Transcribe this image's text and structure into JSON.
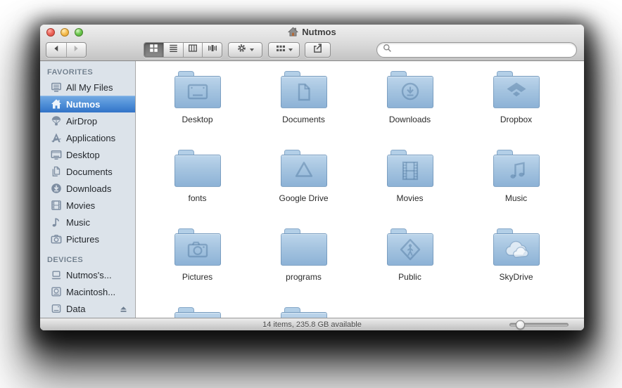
{
  "window": {
    "title": "Nutmos",
    "title_icon": "home-icon",
    "controls": [
      {
        "name": "close",
        "color": "#ee6a5f"
      },
      {
        "name": "minimize",
        "color": "#f6bd50"
      },
      {
        "name": "zoom",
        "color": "#6bc74e"
      }
    ]
  },
  "toolbar": {
    "nav": [
      {
        "name": "back",
        "icon": "back-arrow-icon",
        "enabled": true
      },
      {
        "name": "forward",
        "icon": "forward-arrow-icon",
        "enabled": false
      }
    ],
    "views": [
      {
        "name": "icon-view",
        "icon": "icon-view-icon",
        "selected": true
      },
      {
        "name": "list-view",
        "icon": "list-view-icon",
        "selected": false
      },
      {
        "name": "column-view",
        "icon": "column-view-icon",
        "selected": false
      },
      {
        "name": "coverflow-view",
        "icon": "coverflow-view-icon",
        "selected": false
      }
    ],
    "action_menu": {
      "icon": "gear-icon",
      "has_caret": true
    },
    "arrange_menu": {
      "icon": "arrange-grid-icon",
      "has_caret": true
    },
    "share_button": {
      "icon": "share-icon"
    },
    "search": {
      "icon": "search-icon",
      "value": "",
      "placeholder": ""
    }
  },
  "sidebar": {
    "sections": [
      {
        "title": "FAVORITES",
        "items": [
          {
            "label": "All My Files",
            "icon": "all-my-files-icon",
            "selected": false
          },
          {
            "label": "Nutmos",
            "icon": "home-icon",
            "selected": true
          },
          {
            "label": "AirDrop",
            "icon": "airdrop-icon",
            "selected": false
          },
          {
            "label": "Applications",
            "icon": "applications-icon",
            "selected": false
          },
          {
            "label": "Desktop",
            "icon": "desktop-icon",
            "selected": false
          },
          {
            "label": "Documents",
            "icon": "documents-icon",
            "selected": false
          },
          {
            "label": "Downloads",
            "icon": "downloads-icon",
            "selected": false
          },
          {
            "label": "Movies",
            "icon": "movies-icon",
            "selected": false
          },
          {
            "label": "Music",
            "icon": "music-icon",
            "selected": false
          },
          {
            "label": "Pictures",
            "icon": "pictures-icon",
            "selected": false
          }
        ]
      },
      {
        "title": "DEVICES",
        "items": [
          {
            "label": "Nutmos's...",
            "icon": "laptop-icon",
            "selected": false
          },
          {
            "label": "Macintosh...",
            "icon": "harddrive-icon",
            "selected": false
          },
          {
            "label": "Data",
            "icon": "disk-icon",
            "selected": false,
            "eject": true
          }
        ]
      }
    ]
  },
  "content": {
    "folders": [
      {
        "label": "Desktop",
        "emblem": "desktop"
      },
      {
        "label": "Documents",
        "emblem": "document"
      },
      {
        "label": "Downloads",
        "emblem": "download"
      },
      {
        "label": "Dropbox",
        "emblem": "dropbox"
      },
      {
        "label": "fonts",
        "emblem": "none"
      },
      {
        "label": "Google Drive",
        "emblem": "gdrive"
      },
      {
        "label": "Movies",
        "emblem": "film"
      },
      {
        "label": "Music",
        "emblem": "music"
      },
      {
        "label": "Pictures",
        "emblem": "camera"
      },
      {
        "label": "programs",
        "emblem": "none"
      },
      {
        "label": "Public",
        "emblem": "public"
      },
      {
        "label": "SkyDrive",
        "emblem": "clouds"
      }
    ],
    "partially_visible_folders": 2
  },
  "statusbar": {
    "text": "14 items, 235.8 GB available",
    "size_slider_percent": 18
  },
  "colors": {
    "sidebar_bg": "#dce3ea",
    "selection_top": "#74abe4",
    "selection_bottom": "#3273c7",
    "folder_top": "#bcd5eb",
    "folder_bottom": "#8db2d6",
    "titlebar_top": "#efefef",
    "titlebar_bottom": "#c3c3c3"
  }
}
